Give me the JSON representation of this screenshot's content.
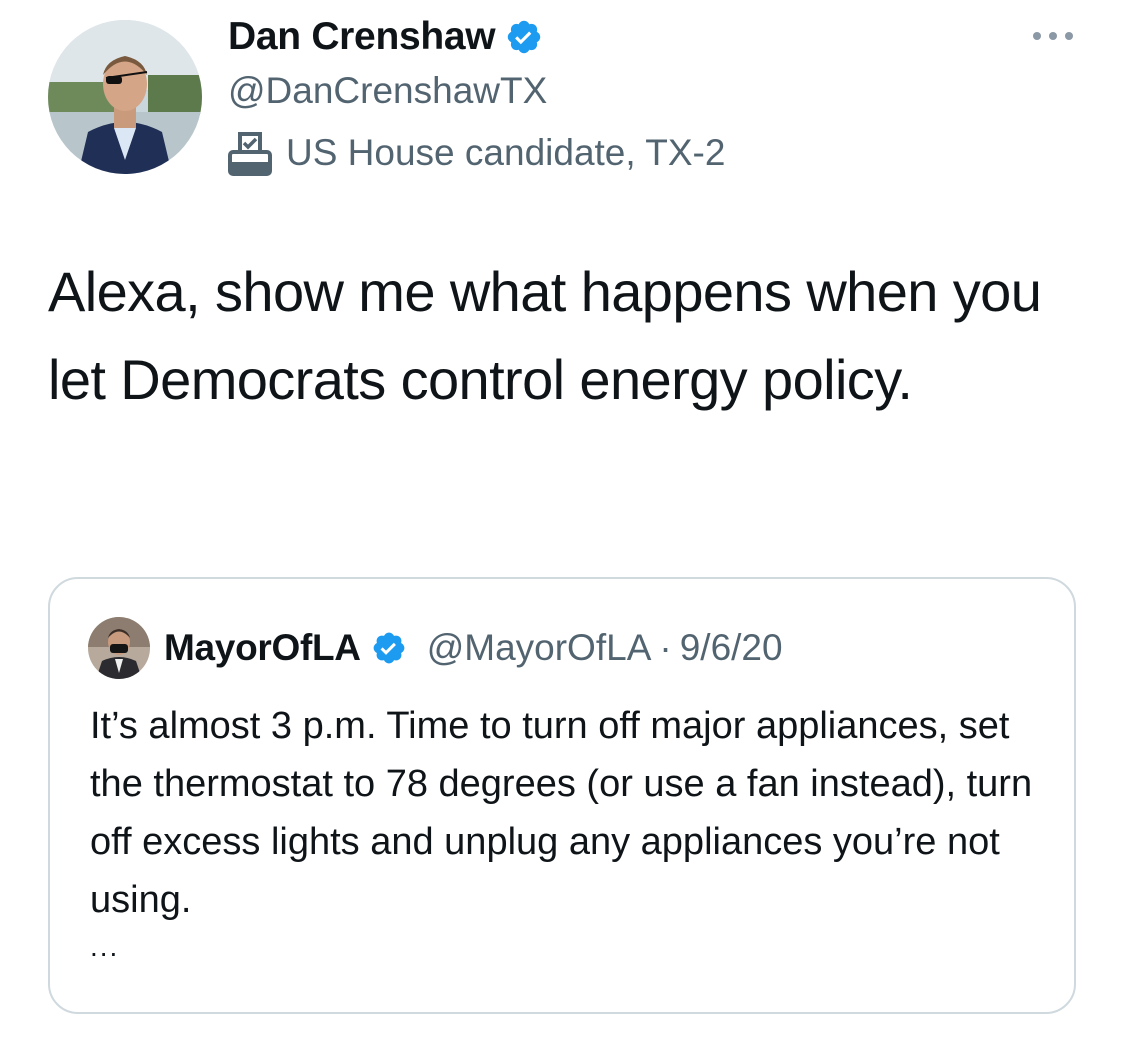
{
  "author": {
    "display_name": "Dan Crenshaw",
    "handle": "@DanCrenshawTX",
    "label": "US House candidate, TX-2",
    "verified_icon": "verified-badge-icon",
    "label_icon": "ballot-box-icon"
  },
  "tweet": {
    "text": "Alexa, show me what happens when you let Democrats control energy policy."
  },
  "quoted_tweet": {
    "display_name": "MayorOfLA",
    "handle": "@MayorOfLA",
    "separator": "·",
    "date": "9/6/20",
    "text": "It’s almost 3 p.m. Time to turn off major appliances, set the thermostat to 78 degrees (or use a fan instead), turn off excess lights and unplug any appliances you’re not using.",
    "truncation": "..."
  },
  "colors": {
    "primary_text": "#0f1419",
    "secondary_text": "#536471",
    "verified_blue": "#1d9bf0",
    "border": "#cfd9de"
  }
}
